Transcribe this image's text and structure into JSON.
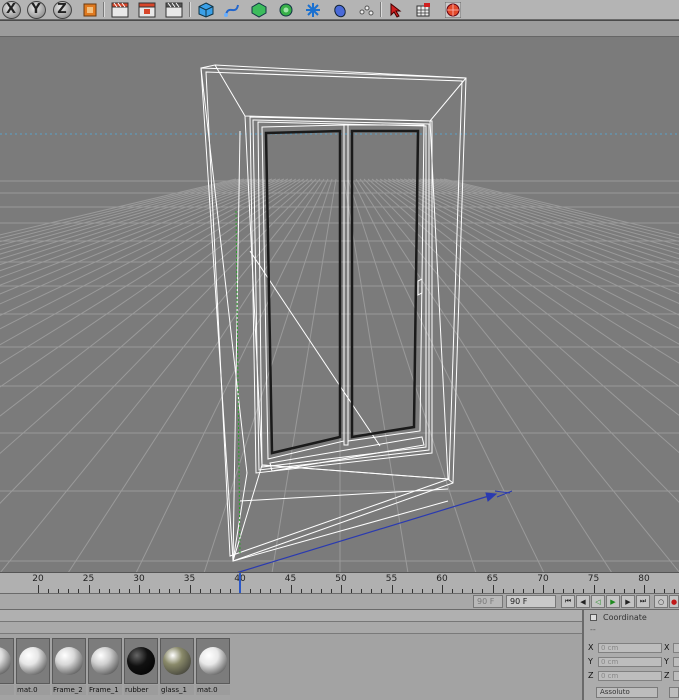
{
  "toolbar": {
    "axis_buttons": [
      "X",
      "Y",
      "Z"
    ],
    "icons": [
      "coordinate-system-icon",
      "render-view-icon",
      "render-picture-viewer-icon",
      "render-settings-icon",
      "cube-icon",
      "spline-pen-icon",
      "nurbs-icon",
      "array-icon",
      "deformer-icon",
      "scene-icon",
      "light-icon",
      "select-icon",
      "snap-icon",
      "render-globe-icon"
    ]
  },
  "timeline": {
    "ticks": [
      "20",
      "25",
      "30",
      "35",
      "40",
      "45",
      "50",
      "55",
      "60",
      "65",
      "70",
      "75",
      "80"
    ],
    "current_frame": 40
  },
  "animbar": {
    "min_frame": "90 F",
    "max_frame": "90 F"
  },
  "materials": [
    {
      "name": "",
      "color": "#dcdcdc"
    },
    {
      "name": "mat.0",
      "color": "#e6e6e6"
    },
    {
      "name": "Frame_2",
      "color": "#d8d8d8"
    },
    {
      "name": "Frame_1",
      "color": "#cfcfcf"
    },
    {
      "name": "rubber",
      "color": "#111111"
    },
    {
      "name": "glass_1",
      "color": "#8a8a6a"
    },
    {
      "name": "mat.0",
      "color": "#e8e8e8"
    }
  ],
  "coordinates": {
    "title": "Coordinate",
    "sub": "--",
    "rows": [
      {
        "axis": "X",
        "value": "0 cm",
        "axis2": "X"
      },
      {
        "axis": "Y",
        "value": "0 cm",
        "axis2": "Y"
      },
      {
        "axis": "Z",
        "value": "0 cm",
        "axis2": "Z"
      }
    ],
    "mode": "Assoluto"
  },
  "colors": {
    "viewport_bg": "#7b7b7b",
    "grid_line": "#9a9a9a",
    "wire": "#ffffff",
    "horizon": "#5aa0c8",
    "axis_blue": "#2a3ab0",
    "axis_green": "#2aa02a",
    "playhead": "#2b58c7"
  }
}
